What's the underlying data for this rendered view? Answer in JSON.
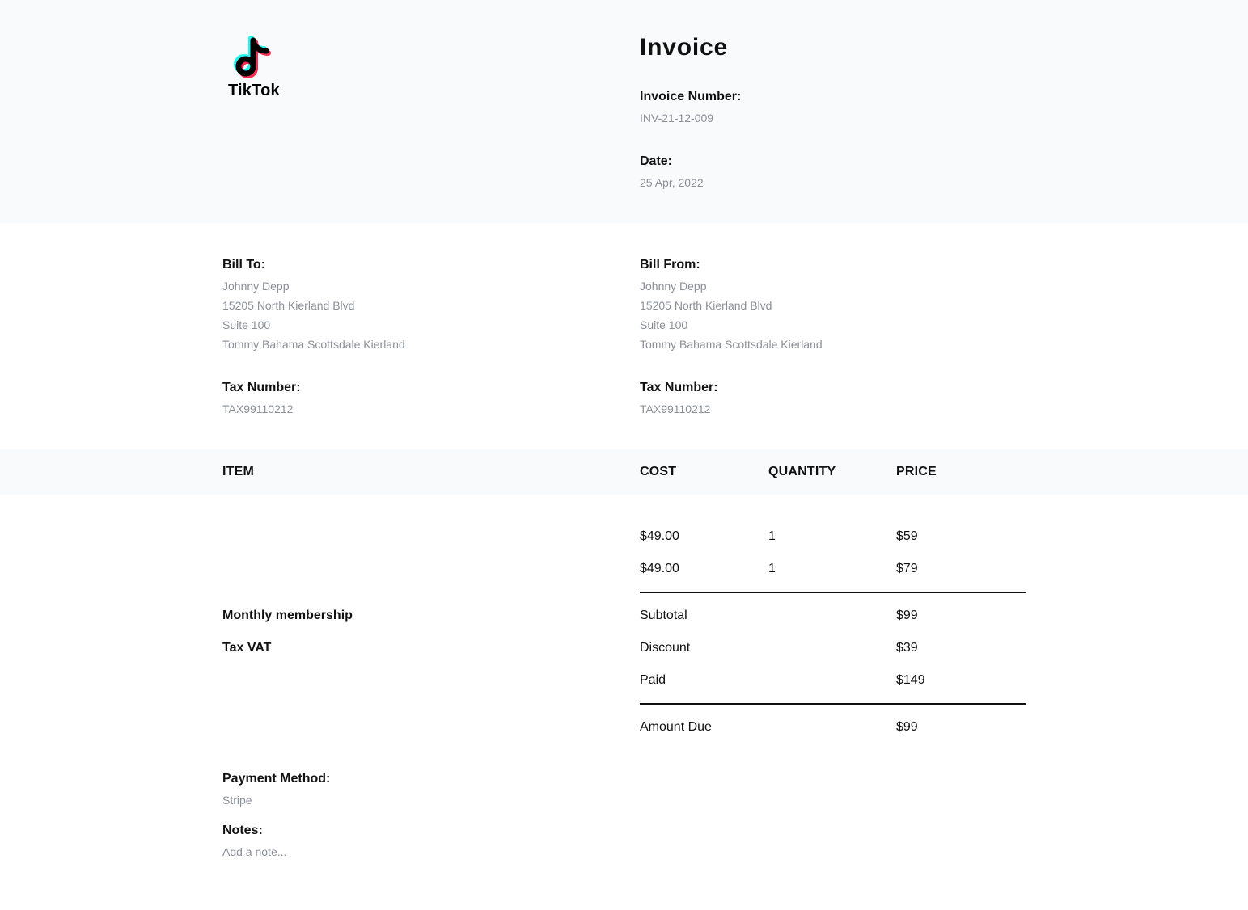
{
  "logo": {
    "brand": "TikTok"
  },
  "header": {
    "title": "Invoice",
    "invoice_number_label": "Invoice Number:",
    "invoice_number": "INV-21-12-009",
    "date_label": "Date:",
    "date": "25 Apr, 2022"
  },
  "bill_to": {
    "label": "Bill To:",
    "lines": [
      "Johnny Depp",
      "15205 North Kierland Blvd",
      "Suite 100",
      "Tommy Bahama Scottsdale Kierland"
    ],
    "tax_label": "Tax Number:",
    "tax_number": "TAX99110212"
  },
  "bill_from": {
    "label": "Bill From:",
    "lines": [
      "Johnny Depp",
      "15205 North Kierland Blvd",
      "Suite 100",
      "Tommy Bahama Scottsdale Kierland"
    ],
    "tax_label": "Tax Number:",
    "tax_number": "TAX99110212"
  },
  "table": {
    "headers": {
      "item": "ITEM",
      "cost": "COST",
      "quantity": "QUANTITY",
      "price": "PRICE"
    },
    "rows": [
      {
        "item": "",
        "cost": "$49.00",
        "quantity": "1",
        "price": "$59"
      },
      {
        "item": "",
        "cost": "$49.00",
        "quantity": "1",
        "price": "$79"
      }
    ],
    "extra_items": [
      "Monthly membership",
      "Tax VAT"
    ]
  },
  "summary": {
    "subtotal_label": "Subtotal",
    "subtotal": "$99",
    "discount_label": "Discount",
    "discount": "$39",
    "paid_label": "Paid",
    "paid": "$149",
    "amount_due_label": "Amount Due",
    "amount_due": "$99"
  },
  "payment": {
    "method_label": "Payment Method:",
    "method": "Stripe",
    "notes_label": "Notes:",
    "notes_placeholder": "Add a note..."
  },
  "colors": {
    "band_bg": "#f9fafb",
    "muted_text": "#8a8f98",
    "text": "#111111",
    "tiktok_cyan": "#25F4EE",
    "tiktok_red": "#FE2C55"
  }
}
